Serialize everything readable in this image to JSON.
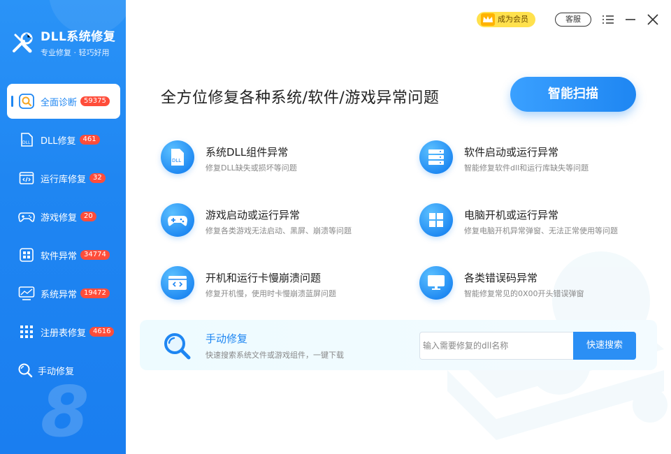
{
  "app": {
    "title": "DLL系统修复",
    "subtitle": "专业修复 · 轻巧好用"
  },
  "topbar": {
    "vip_label": "成为会员",
    "service_label": "客服"
  },
  "sidebar": {
    "items": [
      {
        "label": "全面诊断",
        "count": "59375",
        "icon": "search-icon"
      },
      {
        "label": "DLL修复",
        "count": "461",
        "icon": "dll-file-icon"
      },
      {
        "label": "运行库修复",
        "count": "32",
        "icon": "code-window-icon"
      },
      {
        "label": "游戏修复",
        "count": "20",
        "icon": "gamepad-icon"
      },
      {
        "label": "软件异常",
        "count": "34774",
        "icon": "app-grid-icon"
      },
      {
        "label": "系统异常",
        "count": "19472",
        "icon": "monitor-chart-icon"
      },
      {
        "label": "注册表修复",
        "count": "4616",
        "icon": "registry-grid-icon"
      },
      {
        "label": "手动修复",
        "icon": "magnifier-icon"
      }
    ],
    "watermark": "8"
  },
  "main": {
    "headline": "全方位修复各种系统/软件/游戏异常问题",
    "scan_button": "智能扫描",
    "features": [
      {
        "title": "系统DLL组件异常",
        "desc": "修复DLL缺失或损坏等问题",
        "icon": "dll-file-icon"
      },
      {
        "title": "软件启动或运行异常",
        "desc": "智能修复软件dll和运行库缺失等问题",
        "icon": "server-stack-icon"
      },
      {
        "title": "游戏启动或运行异常",
        "desc": "修复各类游戏无法启动、黑屏、崩溃等问题",
        "icon": "gamepad-icon"
      },
      {
        "title": "电脑开机或运行异常",
        "desc": "修复电脑开机异常弹窗、无法正常使用等问题",
        "icon": "windows-logo-icon"
      },
      {
        "title": "开机和运行卡慢崩溃问题",
        "desc": "修复开机慢，使用时卡慢崩溃蓝屏问题",
        "icon": "code-window-icon"
      },
      {
        "title": "各类错误码异常",
        "desc": "智能修复常见的0X00开头错误弹窗",
        "icon": "monitor-icon"
      }
    ],
    "manual": {
      "title": "手动修复",
      "desc": "快速搜索系统文件或游戏组件，一键下载",
      "placeholder": "输入需要修复的dll名称",
      "button": "快速搜索"
    }
  },
  "colors": {
    "primary": "#1e86f2",
    "badge": "#ff4d3a",
    "vip": "#ffe14d"
  }
}
